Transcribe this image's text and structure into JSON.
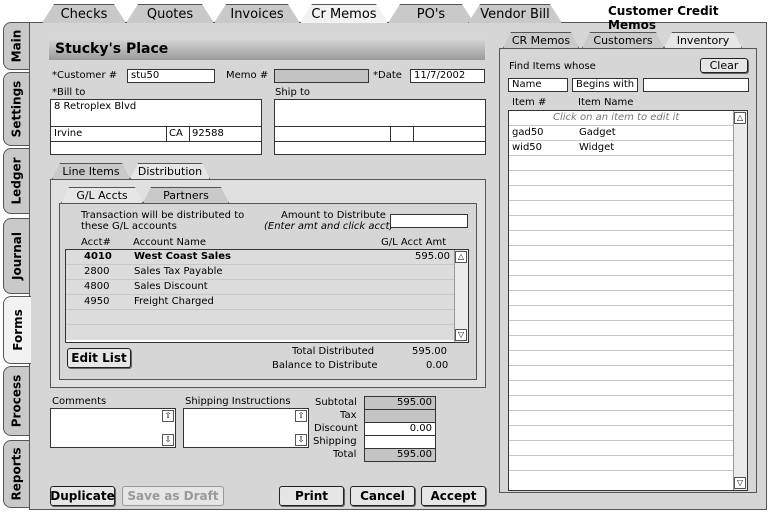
{
  "window_title": "Customer Credit Memos",
  "top_tabs": [
    "Checks",
    "Quotes",
    "Invoices",
    "Cr Memos",
    "PO's",
    "Vendor Bill"
  ],
  "side_tabs": [
    "Main",
    "Settings",
    "Ledger",
    "Journal",
    "Forms",
    "Process",
    "Reports"
  ],
  "company_name": "Stucky's Place",
  "customer_label": "*Customer #",
  "customer_value": "stu50",
  "memo_label": "Memo #",
  "memo_value": "",
  "date_label": "*Date",
  "date_value": "11/7/2002",
  "billto_label": "*Bill to",
  "shipto_label": "Ship to",
  "bill_address": "8 Retroplex Blvd",
  "bill_city": "Irvine",
  "bill_state": "CA",
  "bill_zip": "92588",
  "lower_tabs": [
    "Line Items",
    "Distribution"
  ],
  "gl_tabs": [
    "G/L Accts",
    "Partners"
  ],
  "dist_text_1": "Transaction will be distributed to",
  "dist_text_2": "these G/L accounts",
  "amount_label": "Amount to Distribute",
  "amount_hint": "(Enter amt and click acct)",
  "amount_value": "",
  "col_acct": "Acct#",
  "col_name": "Account Name",
  "col_amt": "G/L Acct Amt",
  "gl_rows": [
    {
      "acct": "4010",
      "name": "West Coast Sales",
      "amt": "595.00"
    },
    {
      "acct": "2800",
      "name": "Sales Tax Payable",
      "amt": ""
    },
    {
      "acct": "4800",
      "name": "Sales Discount",
      "amt": ""
    },
    {
      "acct": "4950",
      "name": "Freight Charged",
      "amt": ""
    }
  ],
  "edit_list_label": "Edit List",
  "total_distributed_label": "Total Distributed",
  "total_distributed_value": "595.00",
  "balance_label": "Balance to Distribute",
  "balance_value": "0.00",
  "comments_label": "Comments",
  "shipping_instr_label": "Shipping Instructions",
  "totals": {
    "subtotal_label": "Subtotal",
    "subtotal": "595.00",
    "tax_label": "Tax",
    "tax": "",
    "discount_label": "Discount",
    "discount": "0.00",
    "shipping_label": "Shipping",
    "shipping": "",
    "total_label": "Total",
    "total": "595.00"
  },
  "buttons": {
    "duplicate": "Duplicate",
    "save_draft": "Save as Draft",
    "print": "Print",
    "cancel": "Cancel",
    "accept": "Accept"
  },
  "right_tabs": [
    "CR Memos",
    "Customers",
    "Inventory"
  ],
  "find_label": "Find Items whose",
  "clear_label": "Clear",
  "find_field": "Name",
  "find_op": "Begins with",
  "find_value": "",
  "item_col_num": "Item #",
  "item_col_name": "Item Name",
  "item_hint": "Click on an item to edit it",
  "items": [
    {
      "num": "gad50",
      "name": "Gadget"
    },
    {
      "num": "wid50",
      "name": "Widget"
    }
  ]
}
